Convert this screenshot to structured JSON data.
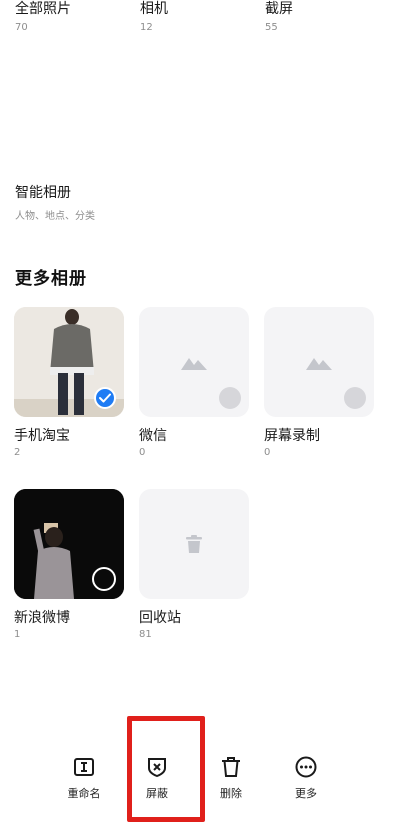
{
  "top_albums": [
    {
      "name": "全部照片",
      "count": "70"
    },
    {
      "name": "相机",
      "count": "12"
    },
    {
      "name": "截屏",
      "count": "55"
    }
  ],
  "smart_album": {
    "title": "智能相册",
    "subtitle": "人物、地点、分类"
  },
  "section_title": "更多相册",
  "albums": [
    {
      "label": "手机淘宝",
      "count": "2"
    },
    {
      "label": "微信",
      "count": "0"
    },
    {
      "label": "屏幕录制",
      "count": "0"
    },
    {
      "label": "新浪微博",
      "count": "1"
    },
    {
      "label": "回收站",
      "count": "81"
    }
  ],
  "toolbar": {
    "rename": "重命名",
    "hide": "屏蔽",
    "delete": "删除",
    "more": "更多"
  },
  "colors": {
    "accent": "#1f7cf4",
    "highlight": "#e0201b"
  },
  "icons": [
    "rename-icon",
    "hide-icon",
    "trash-icon",
    "more-icon",
    "mountain-icon",
    "check-icon"
  ]
}
